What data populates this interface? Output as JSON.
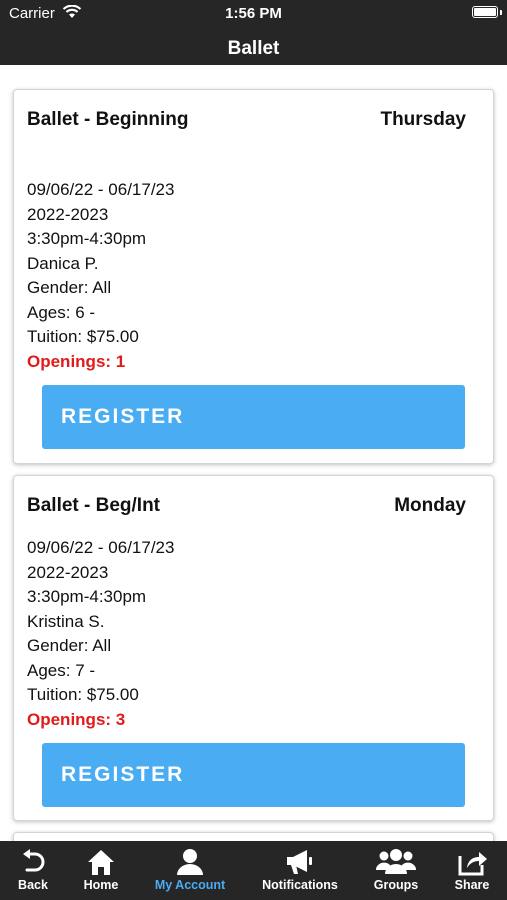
{
  "status": {
    "carrier": "Carrier",
    "time": "1:56 PM"
  },
  "nav": {
    "title": "Ballet"
  },
  "classes": [
    {
      "name": "Ballet - Beginning",
      "day": "Thursday",
      "dates": "09/06/22 - 06/17/23",
      "season": "2022-2023",
      "time": "3:30pm-4:30pm",
      "instructor": "Danica P.",
      "gender": "Gender: All",
      "ages": "Ages: 6 -",
      "tuition": "Tuition: $75.00",
      "openings": "Openings: 1",
      "button": "REGISTER"
    },
    {
      "name": "Ballet - Beg/Int",
      "day": "Monday",
      "dates": "09/06/22 - 06/17/23",
      "season": "2022-2023",
      "time": "3:30pm-4:30pm",
      "instructor": "Kristina S.",
      "gender": "Gender: All",
      "ages": "Ages: 7 -",
      "tuition": "Tuition: $75.00",
      "openings": "Openings: 3",
      "button": "REGISTER"
    }
  ],
  "tabs": [
    {
      "label": "Back",
      "icon": "back-arrow-icon"
    },
    {
      "label": "Home",
      "icon": "home-icon"
    },
    {
      "label": "My Account",
      "icon": "user-icon",
      "active": true
    },
    {
      "label": "Notifications",
      "icon": "megaphone-icon"
    },
    {
      "label": "Groups",
      "icon": "groups-icon"
    },
    {
      "label": "Share",
      "icon": "share-icon"
    }
  ],
  "colors": {
    "bar": "#262626",
    "accent": "#4aacf2",
    "openings": "#e01b1b"
  }
}
